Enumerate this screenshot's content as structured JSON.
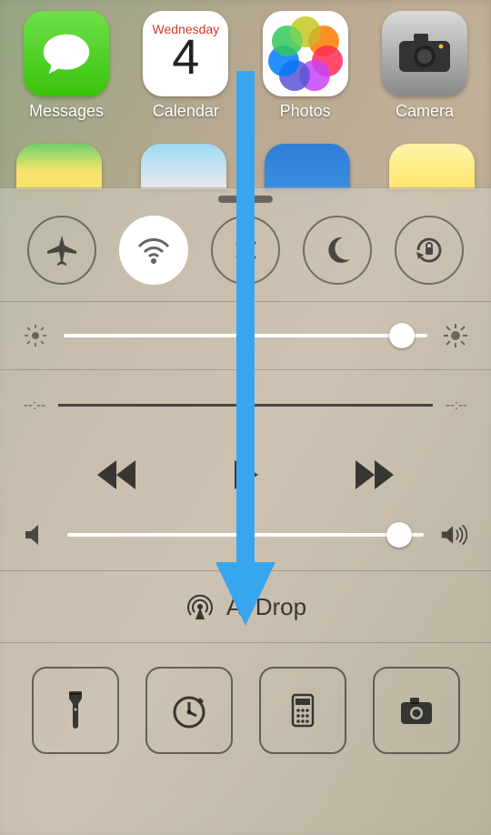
{
  "home": {
    "apps": [
      {
        "label": "Messages"
      },
      {
        "label": "Calendar",
        "weekday": "Wednesday",
        "day": "4"
      },
      {
        "label": "Photos"
      },
      {
        "label": "Camera"
      }
    ]
  },
  "control_center": {
    "toggles": {
      "airplane": {
        "active": false
      },
      "wifi": {
        "active": true
      },
      "bluetooth": {
        "active": false
      },
      "dnd": {
        "active": false
      },
      "rotation_lock": {
        "active": false
      }
    },
    "brightness": {
      "value": 0.93
    },
    "media": {
      "elapsed": "--:--",
      "remaining": "--:--",
      "volume": 0.93
    },
    "airdrop": {
      "label": "AirDrop"
    },
    "quick": {
      "flashlight": "Flashlight",
      "timer": "Timer",
      "calculator": "Calculator",
      "camera": "Camera"
    }
  }
}
